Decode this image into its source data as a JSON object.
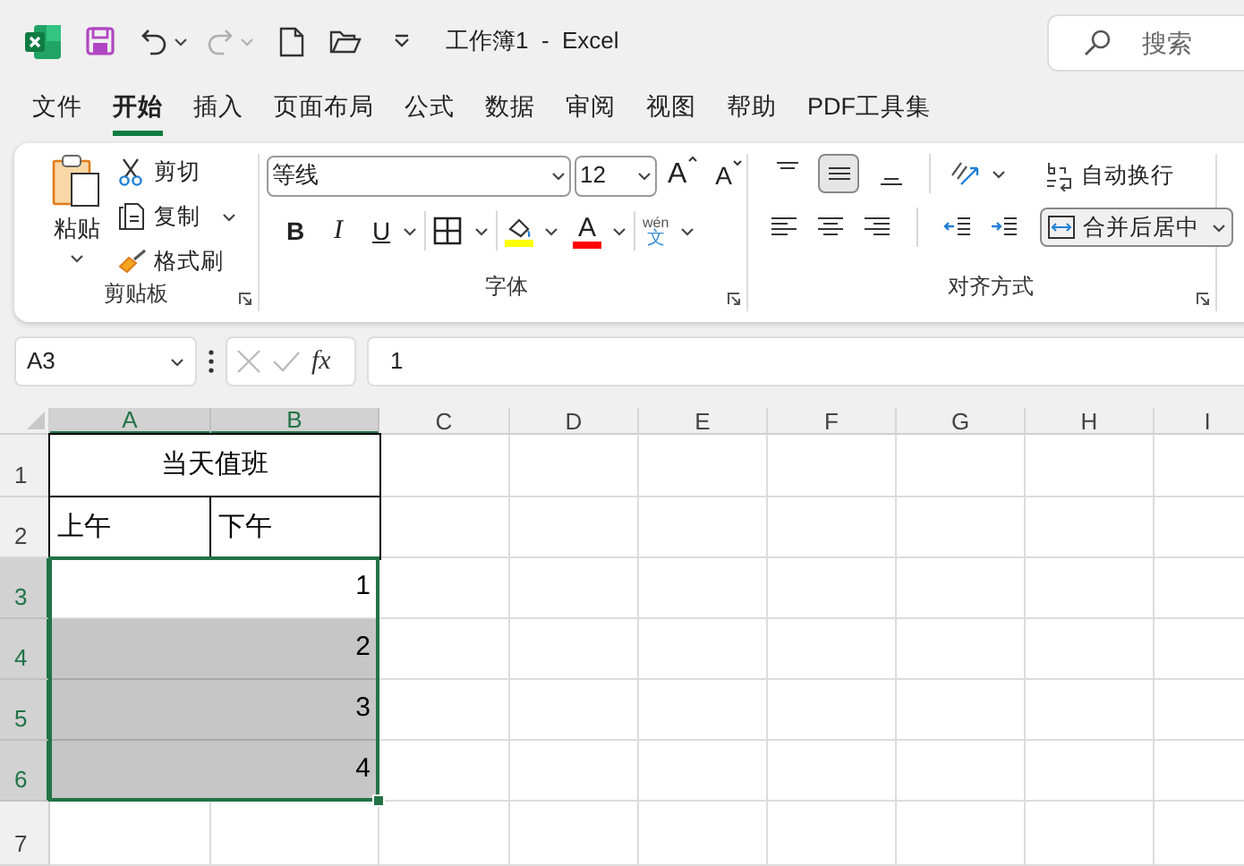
{
  "title_bar": {
    "title": "工作簿1  -  Excel",
    "search_placeholder": "搜索",
    "redo_disabled": true
  },
  "menu_tabs": [
    {
      "label": "文件",
      "selected": false
    },
    {
      "label": "开始",
      "selected": true
    },
    {
      "label": "插入",
      "selected": false
    },
    {
      "label": "页面布局",
      "selected": false
    },
    {
      "label": "公式",
      "selected": false
    },
    {
      "label": "数据",
      "selected": false
    },
    {
      "label": "审阅",
      "selected": false
    },
    {
      "label": "视图",
      "selected": false
    },
    {
      "label": "帮助",
      "selected": false
    },
    {
      "label": "PDF工具集",
      "selected": false
    }
  ],
  "ribbon": {
    "clipboard": {
      "paste": "粘贴",
      "cut": "剪切",
      "copy": "复制",
      "format_painter": "格式刷",
      "label": "剪贴板"
    },
    "font": {
      "font_name": "等线",
      "font_size": "12",
      "grow_font": "A",
      "shrink_font": "A",
      "bold": "B",
      "italic": "I",
      "underline": "U",
      "font_color": "A",
      "phonetic_top": "wén",
      "phonetic_bottom": "文",
      "label": "字体"
    },
    "alignment": {
      "vertical_align": [
        {
          "kind": "top",
          "selected": false
        },
        {
          "kind": "middle",
          "selected": true
        },
        {
          "kind": "bottom",
          "selected": false
        }
      ],
      "wrap_text": "自动换行",
      "merge_center": "合并后居中",
      "label": "对齐方式"
    }
  },
  "formula_bar": {
    "name_box": "A3",
    "fx": "fx",
    "value": "1"
  },
  "sheet": {
    "columns": [
      {
        "label": "A",
        "selected": true
      },
      {
        "label": "B",
        "selected": true
      },
      {
        "label": "C",
        "selected": false
      },
      {
        "label": "D",
        "selected": false
      },
      {
        "label": "E",
        "selected": false
      },
      {
        "label": "F",
        "selected": false
      },
      {
        "label": "G",
        "selected": false
      },
      {
        "label": "H",
        "selected": false
      },
      {
        "label": "I",
        "selected": false
      }
    ],
    "rows": [
      {
        "label": "1",
        "selected": false,
        "cells": [
          {
            "kind": "text",
            "text": "当天值班",
            "merged": true,
            "bordered": true
          }
        ]
      },
      {
        "label": "2",
        "selected": false,
        "cells": [
          {
            "kind": "text",
            "text": "上午",
            "merged": false,
            "bordered": true
          },
          {
            "kind": "text",
            "text": "下午",
            "merged": false,
            "bordered": true
          }
        ]
      },
      {
        "label": "3",
        "selected": true,
        "cells": [
          {
            "kind": "number",
            "text": "1",
            "merged": true,
            "bordered": false,
            "active": true
          }
        ]
      },
      {
        "label": "4",
        "selected": true,
        "cells": [
          {
            "kind": "number",
            "text": "2",
            "merged": true,
            "bordered": false,
            "active": false
          }
        ]
      },
      {
        "label": "5",
        "selected": true,
        "cells": [
          {
            "kind": "number",
            "text": "3",
            "merged": true,
            "bordered": false,
            "active": false
          }
        ]
      },
      {
        "label": "6",
        "selected": true,
        "cells": [
          {
            "kind": "number",
            "text": "4",
            "merged": true,
            "bordered": false,
            "active": false
          }
        ]
      },
      {
        "label": "7",
        "selected": false,
        "cells": []
      }
    ]
  }
}
